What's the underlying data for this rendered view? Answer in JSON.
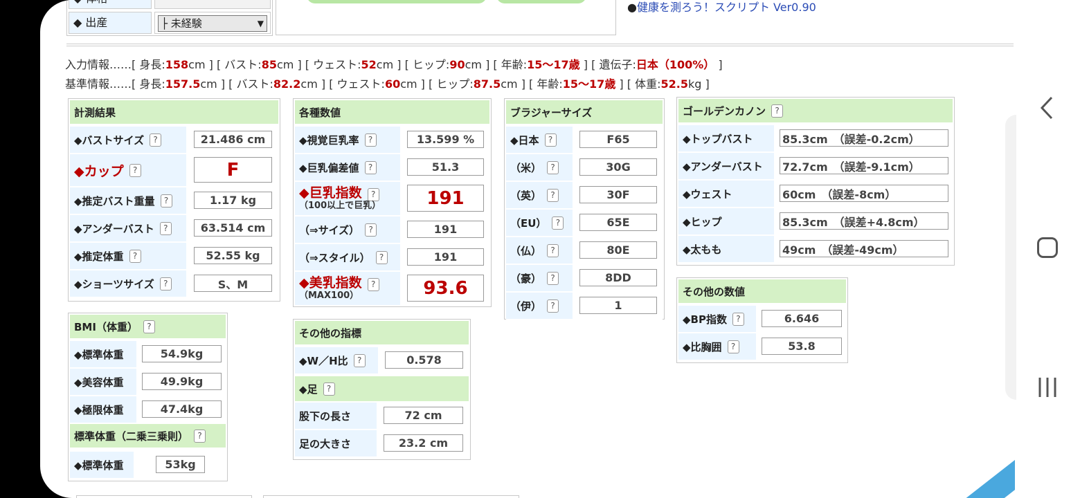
{
  "top": {
    "row1_label": "◆ 体格",
    "row2_label": "◆ 出産",
    "select_value": "├ 未経験",
    "select_arrow": "▼",
    "link": "健康を測ろう！スクリプト Ver0.90"
  },
  "input_info": {
    "prefix": "入力情報……",
    "items": [
      {
        "label": "身長:",
        "value": "158",
        "unit": "cm"
      },
      {
        "label": "バスト:",
        "value": "85",
        "unit": "cm"
      },
      {
        "label": "ウェスト:",
        "value": "52",
        "unit": "cm"
      },
      {
        "label": "ヒップ:",
        "value": "90",
        "unit": "cm"
      },
      {
        "label": "年齢:",
        "value": "15〜17歳",
        "unit": ""
      },
      {
        "label": "遺伝子:",
        "value": "日本（100%）",
        "unit": ""
      }
    ]
  },
  "base_info": {
    "prefix": "基準情報……",
    "items": [
      {
        "label": "身長:",
        "value": "157.5",
        "unit": "cm"
      },
      {
        "label": "バスト:",
        "value": "82.2",
        "unit": "cm"
      },
      {
        "label": "ウェスト:",
        "value": "60",
        "unit": "cm"
      },
      {
        "label": "ヒップ:",
        "value": "87.5",
        "unit": "cm"
      },
      {
        "label": "年齢:",
        "value": "15〜17歳",
        "unit": ""
      },
      {
        "label": "体重:",
        "value": "52.5",
        "unit": "kg"
      }
    ]
  },
  "measure": {
    "title": "計測結果",
    "rows": [
      {
        "label": "◆バストサイズ",
        "value": "21.486 cm"
      },
      {
        "label": "◆カップ",
        "value": "F"
      },
      {
        "label": "◆推定バスト重量",
        "value": "1.17 kg"
      },
      {
        "label": "◆アンダーバスト",
        "value": "63.514 cm"
      },
      {
        "label": "◆推定体重",
        "value": "52.55 kg"
      },
      {
        "label": "◆ショーツサイズ",
        "value": "S、M"
      }
    ]
  },
  "various": {
    "title": "各種数値",
    "rows": [
      {
        "label": "◆視覚巨乳率",
        "sub": "",
        "value": "13.599 %"
      },
      {
        "label": "◆巨乳偏差値",
        "sub": "",
        "value": "51.3"
      },
      {
        "label": "◆巨乳指数",
        "sub": "（100以上で巨乳）",
        "value": "191"
      },
      {
        "label": "（⇒サイズ）",
        "sub": "",
        "value": "191"
      },
      {
        "label": "（⇒スタイル）",
        "sub": "",
        "value": "191"
      },
      {
        "label": "◆美乳指数",
        "sub": "（MAX100）",
        "value": "93.6"
      }
    ]
  },
  "bra": {
    "title": "ブラジャーサイズ",
    "rows": [
      {
        "label": "◆日本",
        "value": "F65"
      },
      {
        "label": "（米）",
        "value": "30G"
      },
      {
        "label": "（英）",
        "value": "30F"
      },
      {
        "label": "（EU）",
        "value": "65E"
      },
      {
        "label": "（仏）",
        "value": "80E"
      },
      {
        "label": "（豪）",
        "value": "8DD"
      },
      {
        "label": "（伊）",
        "value": "1"
      }
    ]
  },
  "golden": {
    "title": "ゴールデンカノン",
    "rows": [
      {
        "label": "◆トップバスト",
        "value": "85.3cm　（誤差-0.2cm）"
      },
      {
        "label": "◆アンダーバスト",
        "value": "72.7cm　（誤差-9.1cm）"
      },
      {
        "label": "◆ウェスト",
        "value": "60cm　（誤差-8cm）"
      },
      {
        "label": "◆ヒップ",
        "value": "85.3cm　（誤差+4.8cm）"
      },
      {
        "label": "◆太もも",
        "value": "49cm　（誤差-49cm）"
      }
    ]
  },
  "other_values": {
    "title": "その他の数値",
    "rows": [
      {
        "label": "◆BP指数",
        "value": "6.646"
      },
      {
        "label": "◆比胸囲",
        "value": "53.8"
      }
    ]
  },
  "bmi": {
    "title": "BMI（体重）",
    "rows": [
      {
        "label": "◆標準体重",
        "value": "54.9kg"
      },
      {
        "label": "◆美容体重",
        "value": "49.9kg"
      },
      {
        "label": "◆極限体重",
        "value": "47.4kg"
      }
    ],
    "title2": "標準体重（二乗三乗則）",
    "rows2": [
      {
        "label": "◆標準体重",
        "value": "53kg"
      }
    ]
  },
  "indices": {
    "title": "その他の指標",
    "wh_label": "◆W／H比",
    "wh_value": "0.578",
    "foot_title": "◆足",
    "rows": [
      {
        "label": "股下の長さ",
        "value": "72 cm"
      },
      {
        "label": "足の大きさ",
        "value": "23.2 cm"
      }
    ]
  },
  "help": "?",
  "colors": {
    "header": "#d5f1c6",
    "label_bg": "#eaf5ff",
    "accent_red": "#b00000",
    "link": "#2a4bb5"
  }
}
